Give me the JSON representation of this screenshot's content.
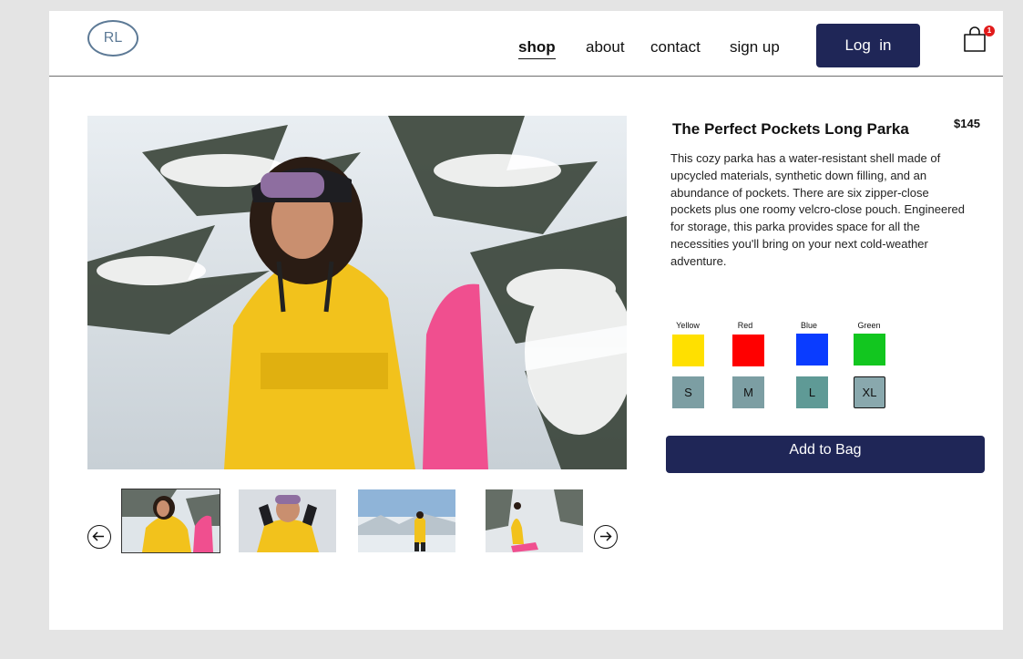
{
  "header": {
    "logo_text": "RL",
    "nav": [
      {
        "label": "shop",
        "active": true
      },
      {
        "label": "about",
        "active": false
      },
      {
        "label": "contact",
        "active": false
      },
      {
        "label": "sign up",
        "active": false
      }
    ],
    "login_label": "Log  in",
    "bag_count": "1"
  },
  "product": {
    "title": "The Perfect Pockets Long Parka",
    "price": "$145",
    "description": "This cozy parka has a water-resistant shell made of upcycled materials, synthetic down filling, and an abundance of pockets. There are six zipper-close pockets plus one roomy velcro-close pouch. Engineered for storage, this parka provides space for all the necessities you'll bring on your next cold-weather adventure.",
    "colors": [
      {
        "label": "Yellow",
        "hex": "#ffe000"
      },
      {
        "label": "Red",
        "hex": "#ff0000"
      },
      {
        "label": "Blue",
        "hex": "#0a3cff"
      },
      {
        "label": "Green",
        "hex": "#12c61f"
      }
    ],
    "sizes": [
      {
        "label": "S",
        "hex": "#7c9ea3",
        "selected": false
      },
      {
        "label": "M",
        "hex": "#7c9ea3",
        "selected": false
      },
      {
        "label": "L",
        "hex": "#5f9a96",
        "selected": false
      },
      {
        "label": "XL",
        "hex": "#89a8ad",
        "selected": true
      }
    ],
    "add_to_bag_label": "Add to Bag"
  },
  "gallery": {
    "thumbnails": [
      "photo-1",
      "photo-2",
      "photo-3",
      "photo-4"
    ],
    "selected_index": 0
  },
  "colors": {
    "navy": "#1f2657",
    "parka_yellow": "#f2c21c"
  }
}
